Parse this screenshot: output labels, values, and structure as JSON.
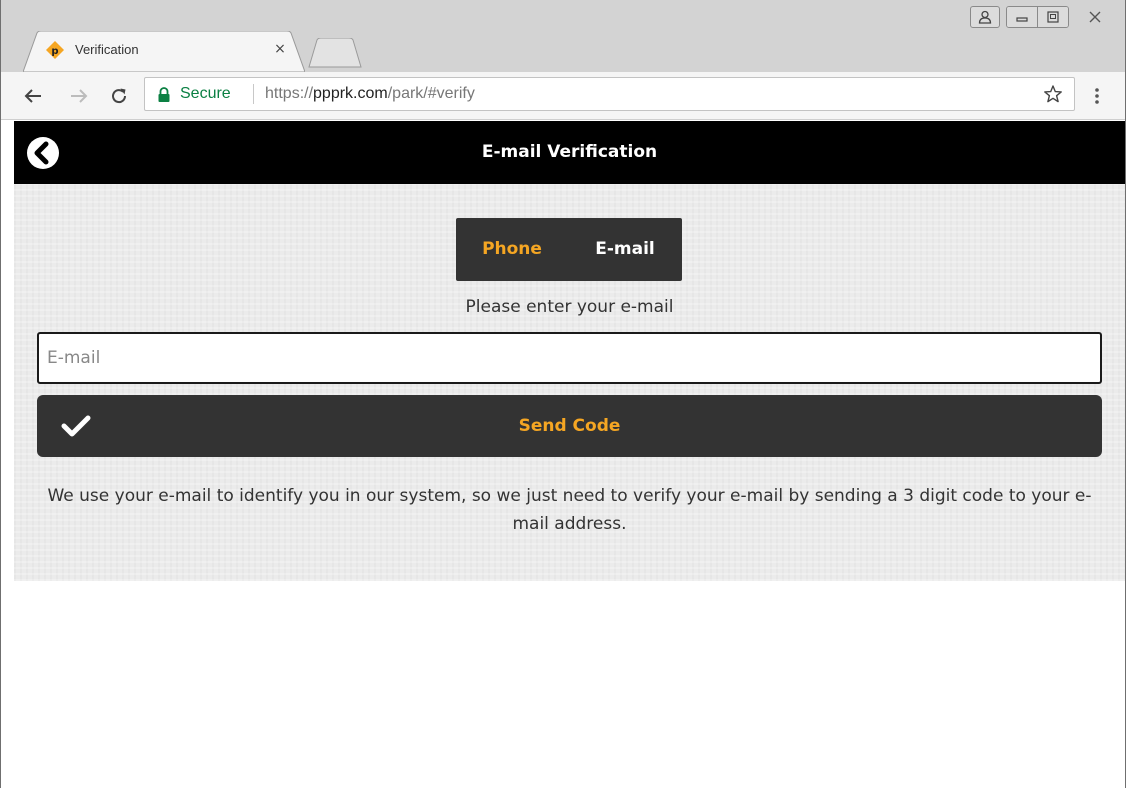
{
  "browser": {
    "tab": {
      "title": "Verification",
      "favicon": "parking-p-icon",
      "close_glyph": "×"
    },
    "address_bar": {
      "security_label": "Secure",
      "url_scheme": "https://",
      "url_host": "ppprk.com",
      "url_path": "/park/#verify"
    },
    "colors": {
      "secure_green": "#0b8043"
    }
  },
  "page": {
    "header": {
      "title": "E-mail Verification"
    },
    "method_toggle": {
      "options": [
        {
          "label": "Phone"
        },
        {
          "label": "E-mail"
        }
      ]
    },
    "prompt": "Please enter your e-mail",
    "email_field": {
      "placeholder": "E-mail",
      "value": ""
    },
    "send_button": {
      "label": "Send Code"
    },
    "info_text": "We use your e-mail to identify you in our system, so we just need to verify your e-mail by sending a 3 digit code to your e-mail address.",
    "colors": {
      "accent": "#f5a623",
      "dark": "#333333",
      "header_bg": "#000000"
    }
  }
}
